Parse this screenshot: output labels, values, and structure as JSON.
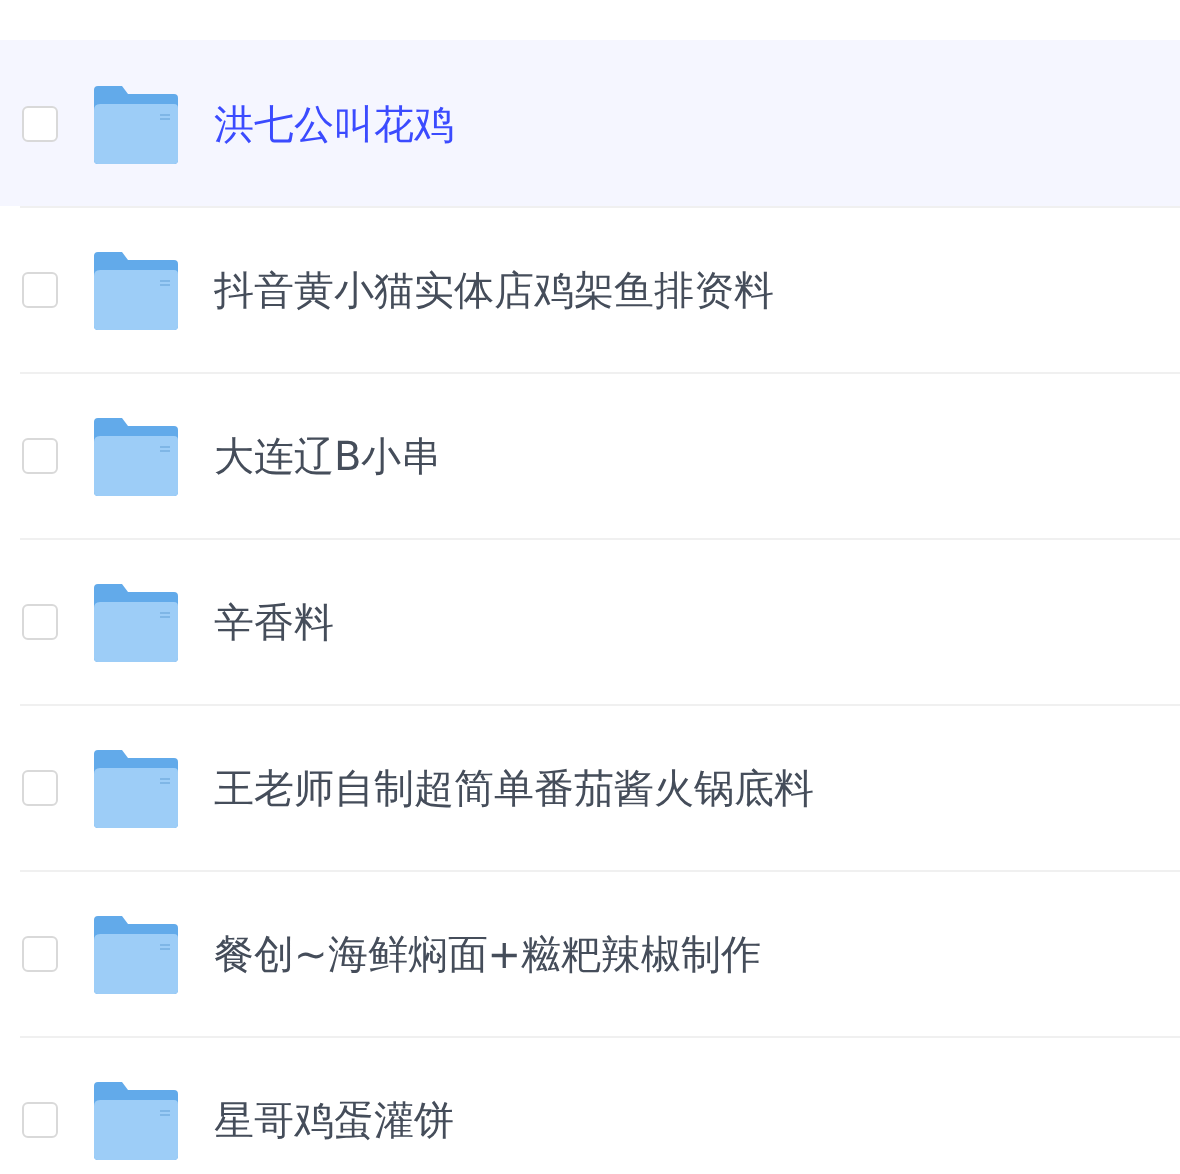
{
  "files": [
    {
      "name": "洪七公叫花鸡",
      "selected": true,
      "checked": false
    },
    {
      "name": "抖音黄小猫实体店鸡架鱼排资料",
      "selected": false,
      "checked": false
    },
    {
      "name": "大连辽B小串",
      "selected": false,
      "checked": false
    },
    {
      "name": "辛香料",
      "selected": false,
      "checked": false
    },
    {
      "name": "王老师自制超简单番茄酱火锅底料",
      "selected": false,
      "checked": false
    },
    {
      "name": "餐创~海鲜焖面+糍粑辣椒制作",
      "selected": false,
      "checked": false
    },
    {
      "name": "星哥鸡蛋灌饼",
      "selected": false,
      "checked": false
    }
  ]
}
